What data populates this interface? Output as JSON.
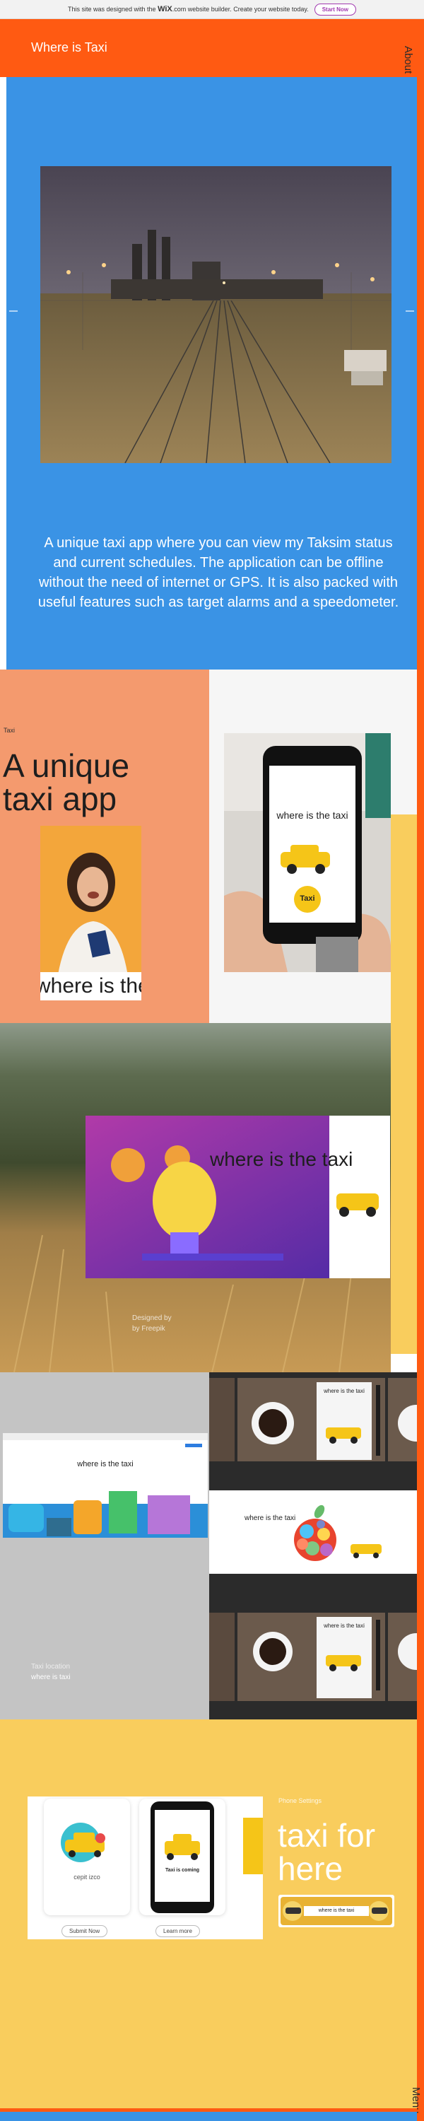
{
  "wix_banner": {
    "text_before": "This site was designed with the",
    "brand": "WiX",
    "text_after": ".com website builder. Create your website today.",
    "button": "Start Now"
  },
  "header": {
    "title": "Where is Taxi",
    "nav_about": "About"
  },
  "hero": {
    "description": "A unique taxi app where you can view my Taksim status and current schedules. The application can be offline without the need of internet or GPS. It is also packed with useful features such as target alarms and a speedometer."
  },
  "section2": {
    "small_label": "Taxi",
    "heading": "A unique taxi app",
    "woman_overlay_text": "where is the taxi",
    "phone_text": "where is the taxi",
    "phone_badge": "Taxi"
  },
  "section3": {
    "card_text": "where is the taxi",
    "photo_credit_line1": "Designed by",
    "photo_credit_line2": "by Freepik"
  },
  "section4": {
    "browser_text": "where is the taxi",
    "tile_texts": [
      "where is the taxi",
      "where is the taxi",
      "where is the taxi"
    ],
    "caption_line1": "Taxi location",
    "caption_line2": "where is taxi"
  },
  "section5": {
    "small_label": "Phone Settings",
    "heading": "taxi for here",
    "pill_text": "where is the taxi",
    "card1_text": "cepit izco",
    "card2_text": "Taxi is coming",
    "button1": "Submit Now",
    "button2": "Learn more",
    "nav_menu": "Menu"
  },
  "colors": {
    "orange": "#ff5a12",
    "blue": "#3a93e5",
    "salmon": "#f49a6e",
    "yellow": "#f9cd5d",
    "gray": "#c4c4c4"
  }
}
